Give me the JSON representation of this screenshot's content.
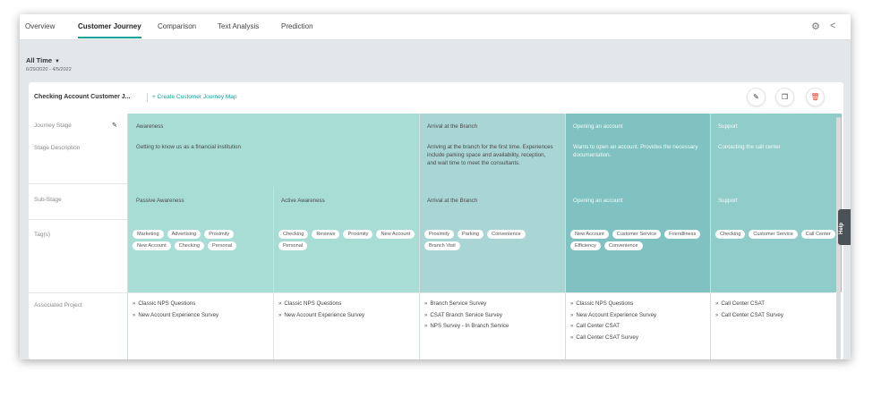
{
  "tabs": [
    "Overview",
    "Customer Journey",
    "Comparison",
    "Text Analysis",
    "Prediction"
  ],
  "active_tab": "Customer Journey",
  "icons": {
    "settings": "gear-icon",
    "share": "share-icon"
  },
  "filter": {
    "label": "All Time",
    "dates": "6/29/2020 - 4/5/2022"
  },
  "card": {
    "title": "Checking Account Customer J...",
    "create_link": "+ Create Customer Journey Map"
  },
  "row_labels": {
    "stage": "Journey Stage",
    "description": "Stage Description",
    "substage": "Sub-Stage",
    "tags": "Tag(s)",
    "projects": "Associated Project"
  },
  "colors": {
    "stage1": "#a8ddd6",
    "stage2": "#a9d5d4",
    "stage3": "#7fc2c1",
    "stage4": "#90ccca",
    "accent": "#0fa39a",
    "danger": "#e14b2e"
  },
  "stages": [
    {
      "name": "Awareness",
      "description": "Getting to know us as a financial institution"
    },
    {
      "name": "Arrival at the Branch",
      "description": "Arriving at the branch for the first time. Experiences include parking space and availability, reception, and wait time to meet the consultants."
    },
    {
      "name": "Opening an account",
      "description": "Wants to open an account. Provides the necessary documentation."
    },
    {
      "name": "Support",
      "description": "Contacting the call center"
    }
  ],
  "substages": [
    {
      "name": "Passive Awareness",
      "tags": [
        "Marketing",
        "Advertising",
        "Proximity",
        "New Account",
        "Checking",
        "Personal"
      ],
      "projects": [
        "Classic NPS Questions",
        "New Account Experience Survey"
      ]
    },
    {
      "name": "Active Awareness",
      "tags": [
        "Checking",
        "Reviews",
        "Proximity",
        "New Account",
        "Personal"
      ],
      "projects": [
        "Classic NPS Questions",
        "New Account Experience Survey"
      ]
    },
    {
      "name": "Arrival at the Branch",
      "tags": [
        "Proximity",
        "Parking",
        "Convenience",
        "Branch Visit"
      ],
      "projects": [
        "Branch Service Survey",
        "CSAT Branch Service Survey",
        "NPS Survey - In Branch Service"
      ]
    },
    {
      "name": "Opening an account",
      "tags": [
        "New Account",
        "Customer Service",
        "Friendliness",
        "Efficiency",
        "Convenience"
      ],
      "projects": [
        "Classic NPS Questions",
        "New Account Experience Survey",
        "Call Center CSAT",
        "Call Center CSAT Survey"
      ]
    },
    {
      "name": "Support",
      "tags": [
        "Checking",
        "Customer Service",
        "Call Center"
      ],
      "projects": [
        "Call Center CSAT",
        "Call Center CSAT Survey"
      ]
    }
  ],
  "help_label": "Help"
}
